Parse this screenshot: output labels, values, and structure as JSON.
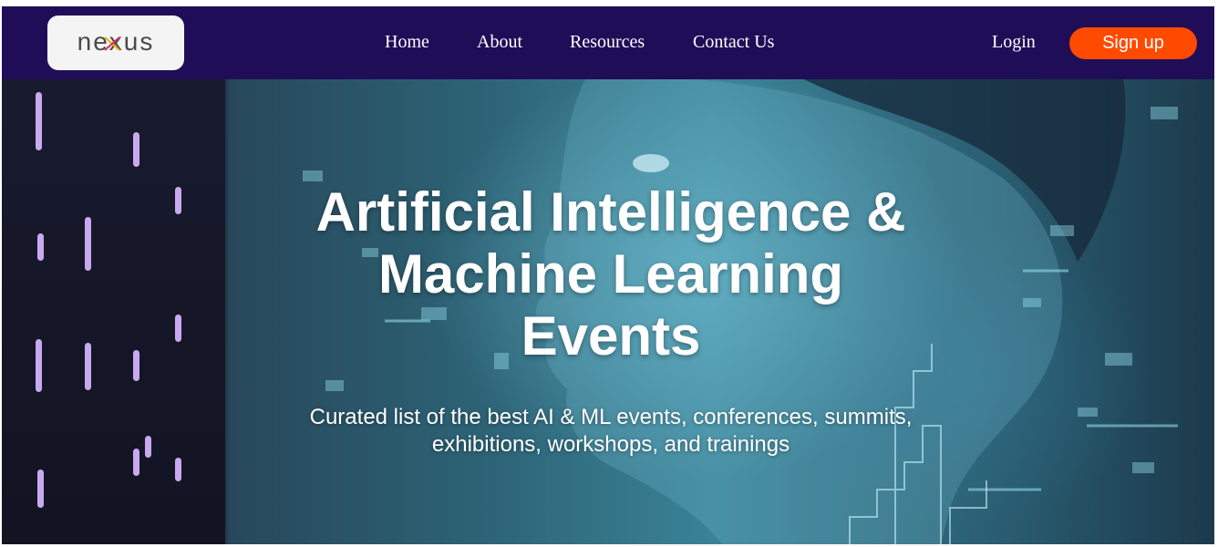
{
  "brand": {
    "logo_text": "nexus"
  },
  "nav": {
    "links": [
      "Home",
      "About",
      "Resources",
      "Contact Us"
    ],
    "login": "Login",
    "signup": "Sign up"
  },
  "hero": {
    "headline_lines": [
      "Artificial Intelligence &",
      "Machine Learning",
      "Events"
    ],
    "subtitle_lines": [
      "Curated list of the best AI & ML events, conferences, summits,",
      "exhibitions, workshops, and trainings"
    ],
    "image_subject": "digital human profile illustration"
  },
  "colors": {
    "navbar": "#200d58",
    "signup_button": "#ff4a00",
    "text": "#ffffff",
    "bar_accent": "#c8a9ef"
  }
}
